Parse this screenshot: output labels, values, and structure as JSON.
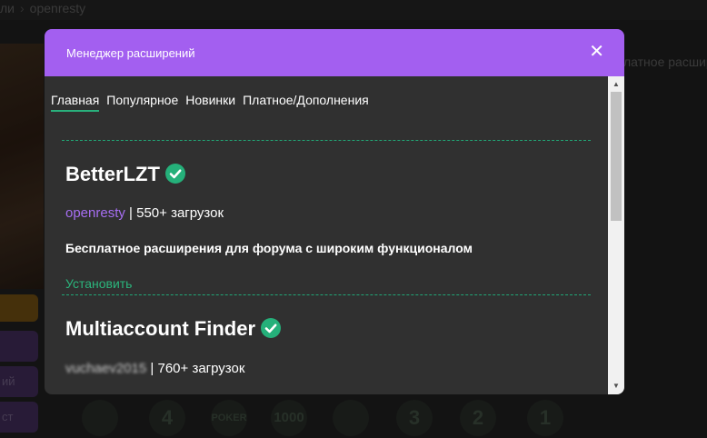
{
  "background": {
    "breadcrumb": [
      "ли",
      "openresty"
    ],
    "left_buttons": [
      "",
      "ий",
      "ст"
    ],
    "right_text": "латное расшир",
    "badges": [
      "4",
      "POKER",
      "1000",
      "",
      "3",
      "2",
      "1"
    ]
  },
  "modal": {
    "title": "Менеджер расширений",
    "close_icon": "close-icon",
    "tabs": [
      {
        "label": "Главная",
        "active": true
      },
      {
        "label": "Популярное",
        "active": false
      },
      {
        "label": "Новинки",
        "active": false
      },
      {
        "label": "Платное/Дополнения",
        "active": false
      }
    ],
    "extensions": [
      {
        "name": "BetterLZT",
        "verified": true,
        "author": "openresty",
        "downloads": "| 550+ загрузок",
        "description": "Бесплатное расширения для форума с широким функционалом",
        "install_label": "Установить"
      },
      {
        "name": "Multiaccount Finder",
        "verified": true,
        "author": "vuchaev2015",
        "downloads": "| 760+ загрузок",
        "description": "",
        "install_label": ""
      }
    ]
  },
  "colors": {
    "accent_purple": "#a35ff0",
    "accent_green": "#29b07c",
    "modal_bg": "#303030"
  }
}
